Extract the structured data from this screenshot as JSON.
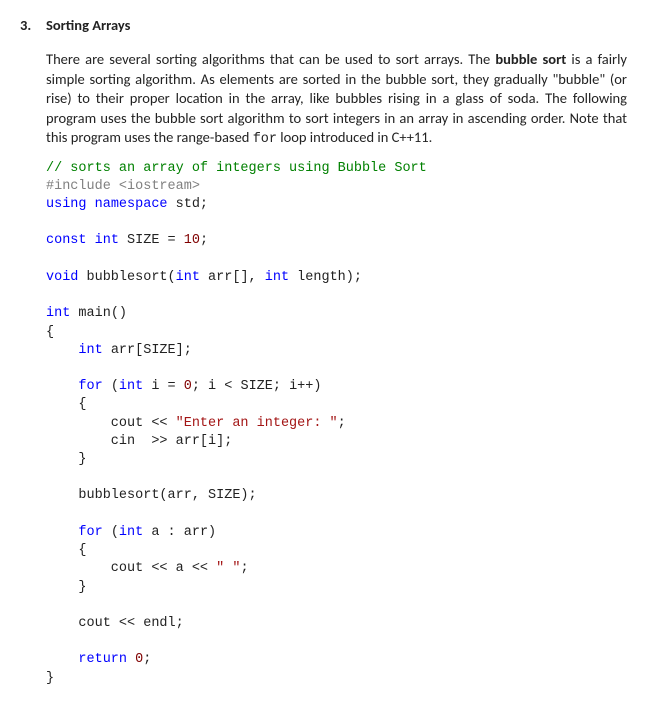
{
  "heading": {
    "number": "3.",
    "title": "Sorting Arrays"
  },
  "paragraph": {
    "p1": "There are several sorting algorithms that can be used to sort arrays. The",
    "bubble_sort": "bubble sort",
    "p2": "is a fairly simple sorting algorithm. As elements are sorted in the bubble sort, they gradually \"bubble\" (or rise) to their proper location in the array, like bubbles rising in a glass of soda. The following program uses the bubble sort algorithm to sort integers in an array in ascending order. Note that this program uses the range-based",
    "for_kw": "for",
    "p3": "loop introduced in C++11."
  },
  "code": {
    "l01_comment": "// sorts an array of integers using Bubble Sort",
    "l02_include": "#include <iostream>",
    "l03_using": "using",
    "l03_namespace": " namespace",
    "l03_std": " std;",
    "l05_const": "const",
    "l05_int": " int",
    "l05_size": " SIZE = ",
    "l05_ten": "10",
    "l05_semi": ";",
    "l07_void": "void",
    "l07_sig": " bubblesort(",
    "l07_int1": "int",
    "l07_arr": " arr[], ",
    "l07_int2": "int",
    "l07_len": " length);",
    "l09_int": "int",
    "l09_main": " main()",
    "l10_brace": "{",
    "l11_int": "    int",
    "l11_arr": " arr[SIZE];",
    "l13_for": "    for",
    "l13_open": " (",
    "l13_int": "int",
    "l13_init": " i = ",
    "l13_zero": "0",
    "l13_rest": "; i < SIZE; i++)",
    "l14_brace": "    {",
    "l15_cout": "        cout << ",
    "l15_str": "\"Enter an integer: \"",
    "l15_semi": ";",
    "l16_cin": "        cin  >> arr[i];",
    "l17_brace": "    }",
    "l19_call": "    bubblesort(arr, SIZE);",
    "l21_for": "    for",
    "l21_open": " (",
    "l21_int": "int",
    "l21_rest": " a : arr)",
    "l22_brace": "    {",
    "l23_cout": "        cout << a << ",
    "l23_str": "\" \"",
    "l23_semi": ";",
    "l24_brace": "    }",
    "l26_cout": "    cout << endl;",
    "l28_ret": "    return",
    "l28_zero": " 0",
    "l28_semi": ";",
    "l29_brace": "}"
  }
}
